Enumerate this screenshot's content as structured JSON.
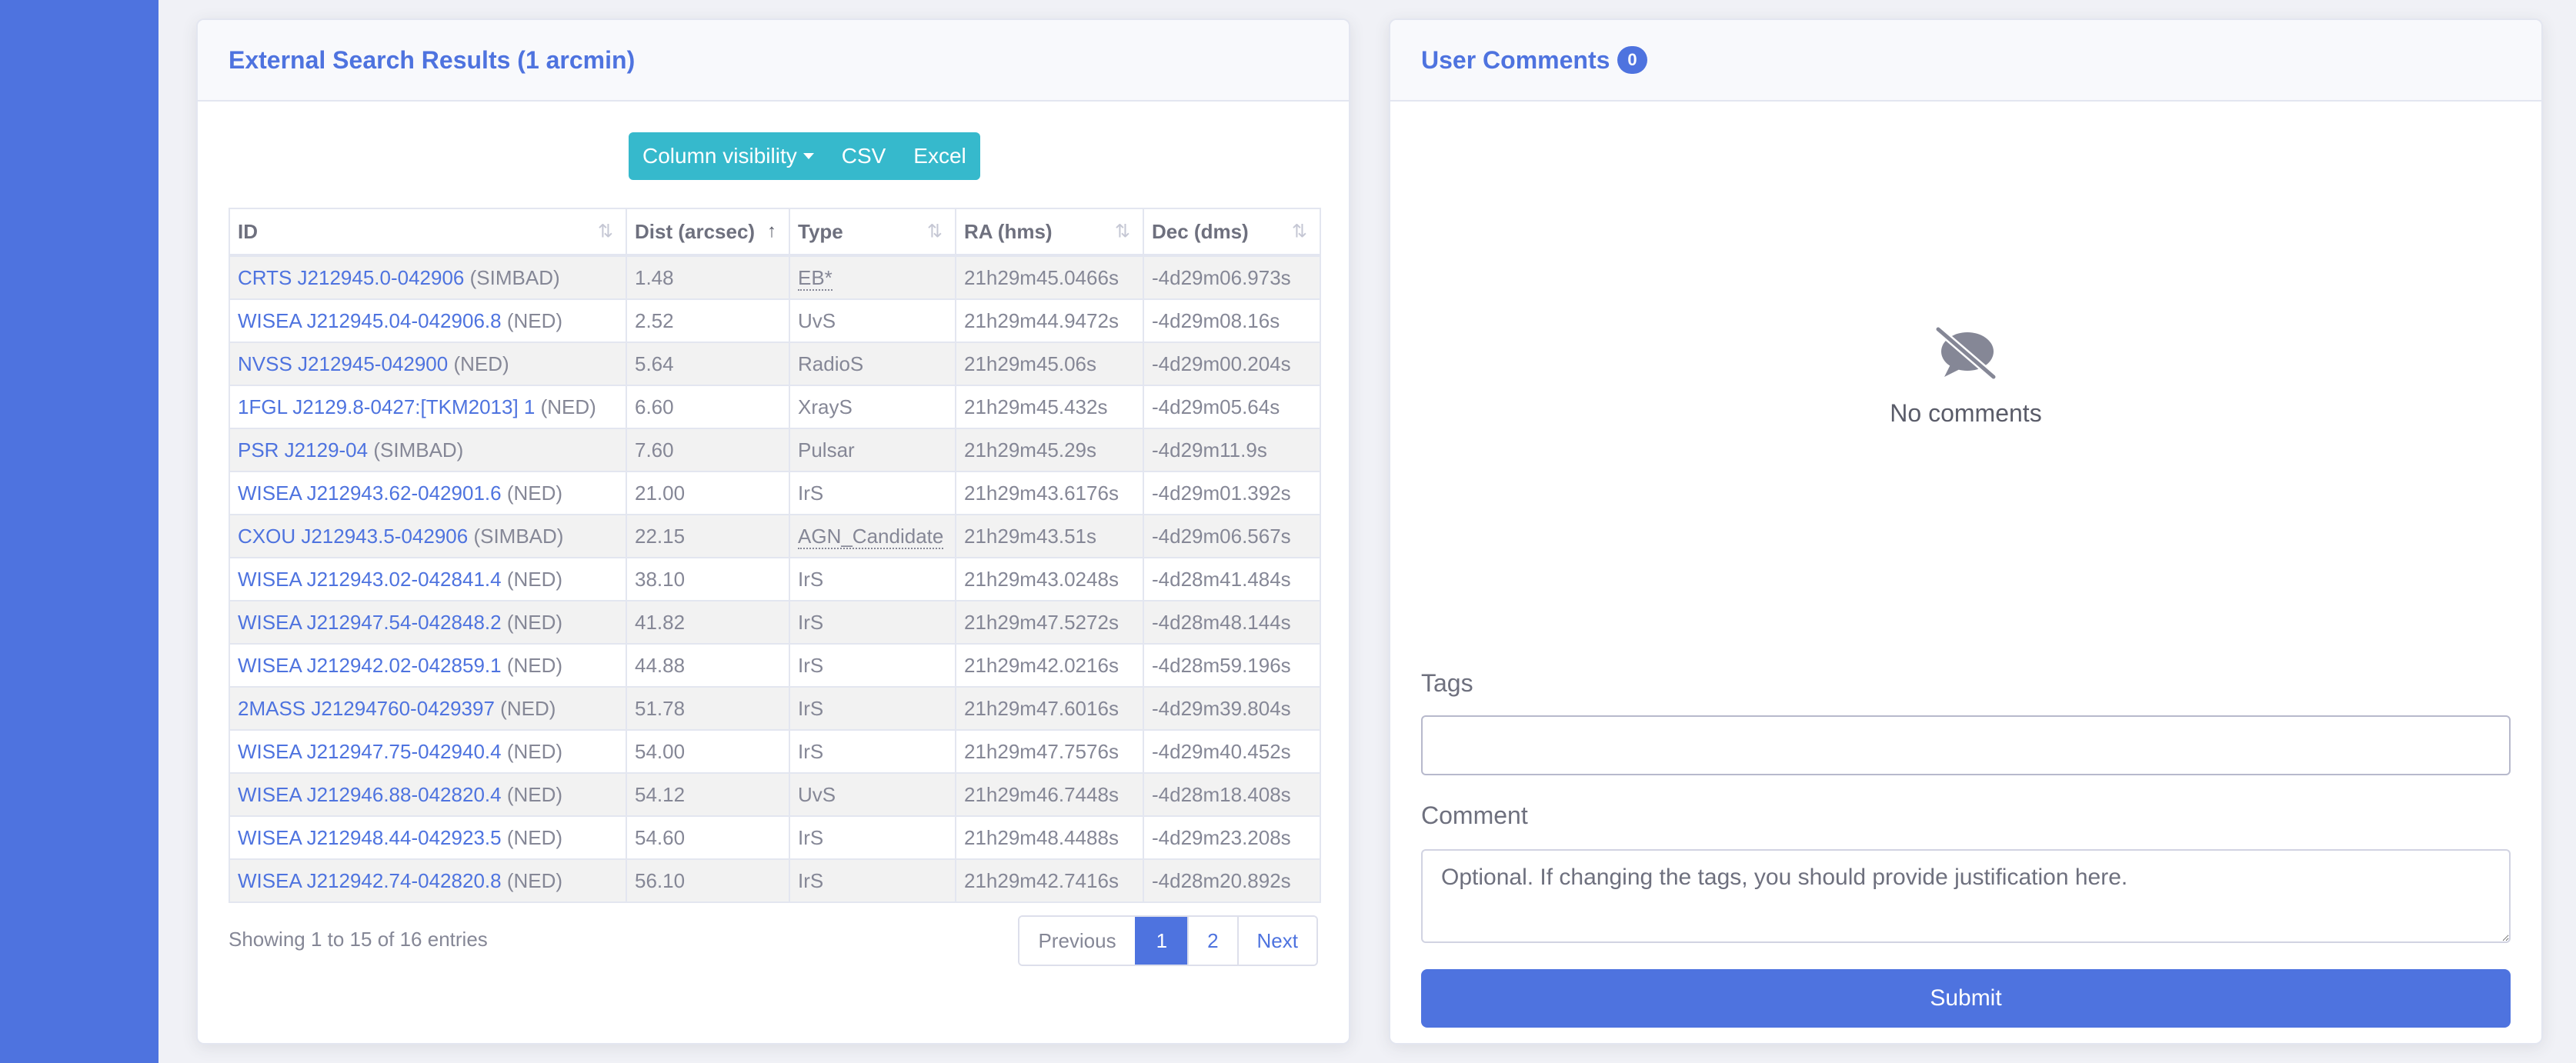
{
  "external": {
    "title": "External Search Results (1 arcmin)",
    "buttons": {
      "columns": "Column visibility",
      "csv": "CSV",
      "excel": "Excel"
    },
    "columns": [
      "ID",
      "Dist (arcsec)",
      "Type",
      "RA (hms)",
      "Dec (dms)"
    ],
    "rows": [
      {
        "id": "CRTS J212945.0-042906",
        "src": "(SIMBAD)",
        "dist": "1.48",
        "type": "EB*",
        "ra": "21h29m45.0466s",
        "dec": "-4d29m06.973s"
      },
      {
        "id": "WISEA J212945.04-042906.8",
        "src": "(NED)",
        "dist": "2.52",
        "type": "UvS",
        "ra": "21h29m44.9472s",
        "dec": "-4d29m08.16s"
      },
      {
        "id": "NVSS J212945-042900",
        "src": "(NED)",
        "dist": "5.64",
        "type": "RadioS",
        "ra": "21h29m45.06s",
        "dec": "-4d29m00.204s"
      },
      {
        "id": "1FGL J2129.8-0427:[TKM2013] 1",
        "src": "(NED)",
        "dist": "6.60",
        "type": "XrayS",
        "ra": "21h29m45.432s",
        "dec": "-4d29m05.64s"
      },
      {
        "id": "PSR J2129-04",
        "src": "(SIMBAD)",
        "dist": "7.60",
        "type": "Pulsar",
        "ra": "21h29m45.29s",
        "dec": "-4d29m11.9s"
      },
      {
        "id": "WISEA J212943.62-042901.6",
        "src": "(NED)",
        "dist": "21.00",
        "type": "IrS",
        "ra": "21h29m43.6176s",
        "dec": "-4d29m01.392s"
      },
      {
        "id": "CXOU J212943.5-042906",
        "src": "(SIMBAD)",
        "dist": "22.15",
        "type": "AGN_Candidate",
        "ra": "21h29m43.51s",
        "dec": "-4d29m06.567s"
      },
      {
        "id": "WISEA J212943.02-042841.4",
        "src": "(NED)",
        "dist": "38.10",
        "type": "IrS",
        "ra": "21h29m43.0248s",
        "dec": "-4d28m41.484s"
      },
      {
        "id": "WISEA J212947.54-042848.2",
        "src": "(NED)",
        "dist": "41.82",
        "type": "IrS",
        "ra": "21h29m47.5272s",
        "dec": "-4d28m48.144s"
      },
      {
        "id": "WISEA J212942.02-042859.1",
        "src": "(NED)",
        "dist": "44.88",
        "type": "IrS",
        "ra": "21h29m42.0216s",
        "dec": "-4d28m59.196s"
      },
      {
        "id": "2MASS J21294760-0429397",
        "src": "(NED)",
        "dist": "51.78",
        "type": "IrS",
        "ra": "21h29m47.6016s",
        "dec": "-4d29m39.804s"
      },
      {
        "id": "WISEA J212947.75-042940.4",
        "src": "(NED)",
        "dist": "54.00",
        "type": "IrS",
        "ra": "21h29m47.7576s",
        "dec": "-4d29m40.452s"
      },
      {
        "id": "WISEA J212946.88-042820.4",
        "src": "(NED)",
        "dist": "54.12",
        "type": "UvS",
        "ra": "21h29m46.7448s",
        "dec": "-4d28m18.408s"
      },
      {
        "id": "WISEA J212948.44-042923.5",
        "src": "(NED)",
        "dist": "54.60",
        "type": "IrS",
        "ra": "21h29m48.4488s",
        "dec": "-4d29m23.208s"
      },
      {
        "id": "WISEA J212942.74-042820.8",
        "src": "(NED)",
        "dist": "56.10",
        "type": "IrS",
        "ra": "21h29m42.7416s",
        "dec": "-4d28m20.892s"
      }
    ],
    "info": "Showing 1 to 15 of 16 entries",
    "pager": {
      "previous": "Previous",
      "page1": "1",
      "page2": "2",
      "next": "Next"
    }
  },
  "comments": {
    "title": "User Comments",
    "count": "0",
    "empty_text": "No comments",
    "tags_label": "Tags",
    "tags_value": "",
    "comment_label": "Comment",
    "comment_placeholder": "Optional. If changing the tags, you should provide justification here.",
    "submit_label": "Submit"
  }
}
